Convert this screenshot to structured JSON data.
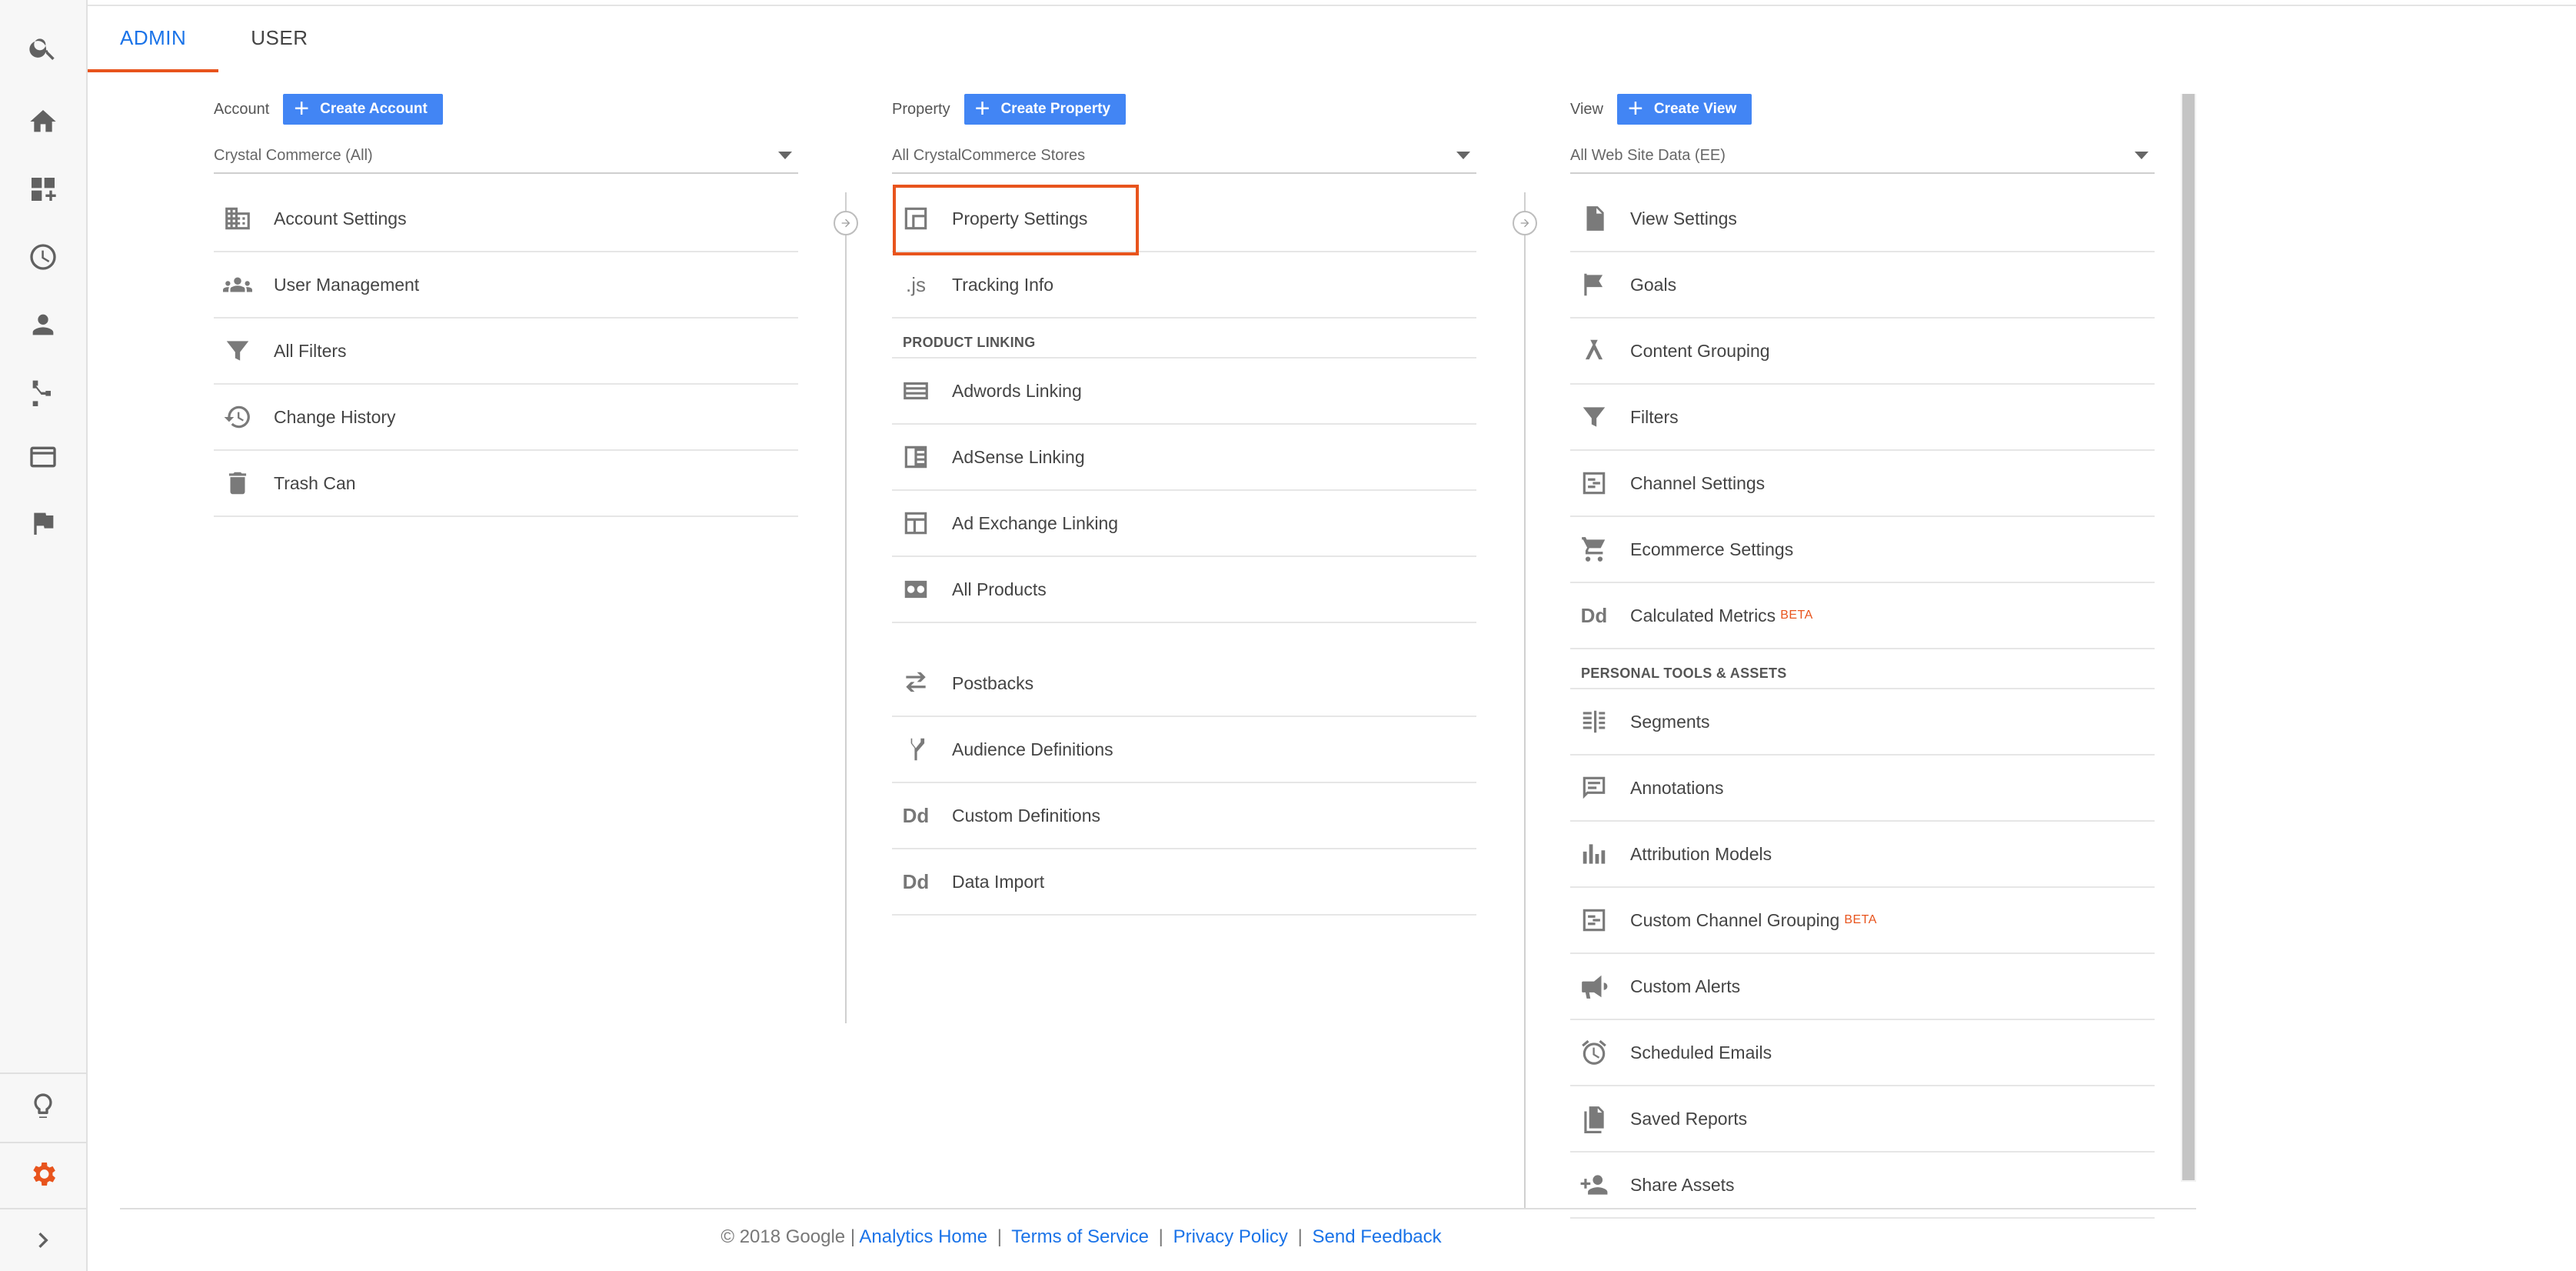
{
  "tabs": [
    {
      "label": "ADMIN",
      "active": true
    },
    {
      "label": "USER",
      "active": false
    }
  ],
  "rail": {
    "icons": [
      "search-icon",
      "home-icon",
      "customization-icon",
      "realtime-icon",
      "audience-icon",
      "acquisition-icon",
      "behavior-icon",
      "conversions-icon",
      "discover-icon",
      "admin-gear-icon",
      "expand-icon"
    ],
    "active_icon": "admin-gear-icon",
    "active_color": "#e8541d"
  },
  "account": {
    "label": "Account",
    "create_label": "Create Account",
    "selected": "Crystal Commerce (All)",
    "items": [
      {
        "label": "Account Settings",
        "icon": "building-icon"
      },
      {
        "label": "User Management",
        "icon": "users-icon"
      },
      {
        "label": "All Filters",
        "icon": "filter-icon"
      },
      {
        "label": "Change History",
        "icon": "history-icon"
      },
      {
        "label": "Trash Can",
        "icon": "trash-icon"
      }
    ]
  },
  "property": {
    "label": "Property",
    "create_label": "Create Property",
    "selected": "All CrystalCommerce Stores",
    "items": [
      {
        "label": "Property Settings",
        "icon": "property-settings-icon"
      },
      {
        "label": "Tracking Info",
        "icon": "js-icon",
        "icon_text": ".js"
      }
    ],
    "section_label": "PRODUCT LINKING",
    "linking": [
      {
        "label": "Adwords Linking",
        "icon": "adwords-icon"
      },
      {
        "label": "AdSense Linking",
        "icon": "adsense-icon"
      },
      {
        "label": "Ad Exchange Linking",
        "icon": "ad-exchange-icon"
      },
      {
        "label": "All Products",
        "icon": "all-products-icon"
      }
    ],
    "more": [
      {
        "label": "Postbacks",
        "icon": "postbacks-icon"
      },
      {
        "label": "Audience Definitions",
        "icon": "audience-definitions-icon"
      },
      {
        "label": "Custom Definitions",
        "icon": "dd-icon",
        "icon_text": "Dd"
      },
      {
        "label": "Data Import",
        "icon": "dd-icon",
        "icon_text": "Dd"
      }
    ]
  },
  "view": {
    "label": "View",
    "create_label": "Create View",
    "selected": "All Web Site Data (EE)",
    "items": [
      {
        "label": "View Settings",
        "icon": "document-icon"
      },
      {
        "label": "Goals",
        "icon": "flag-icon"
      },
      {
        "label": "Content Grouping",
        "icon": "content-grouping-icon"
      },
      {
        "label": "Filters",
        "icon": "filter-icon"
      },
      {
        "label": "Channel Settings",
        "icon": "channel-settings-icon"
      },
      {
        "label": "Ecommerce Settings",
        "icon": "cart-icon"
      },
      {
        "label": "Calculated Metrics",
        "icon": "dd-icon",
        "icon_text": "Dd",
        "badge": "BETA"
      }
    ],
    "section_label": "PERSONAL TOOLS & ASSETS",
    "tools": [
      {
        "label": "Segments",
        "icon": "segments-icon"
      },
      {
        "label": "Annotations",
        "icon": "annotations-icon"
      },
      {
        "label": "Attribution Models",
        "icon": "attribution-icon"
      },
      {
        "label": "Custom Channel Grouping",
        "icon": "channel-grouping-icon",
        "badge": "BETA"
      },
      {
        "label": "Custom Alerts",
        "icon": "megaphone-icon"
      },
      {
        "label": "Scheduled Emails",
        "icon": "alarm-icon"
      },
      {
        "label": "Saved Reports",
        "icon": "saved-reports-icon"
      },
      {
        "label": "Share Assets",
        "icon": "share-assets-icon"
      }
    ]
  },
  "footer": {
    "copyright": "© 2018 Google |",
    "links": [
      "Analytics Home",
      "Terms of Service",
      "Privacy Policy",
      "Send Feedback"
    ],
    "separator": "|"
  },
  "colors": {
    "accent": "#e8541d",
    "button": "#4285f4",
    "link": "#1a73e8"
  }
}
